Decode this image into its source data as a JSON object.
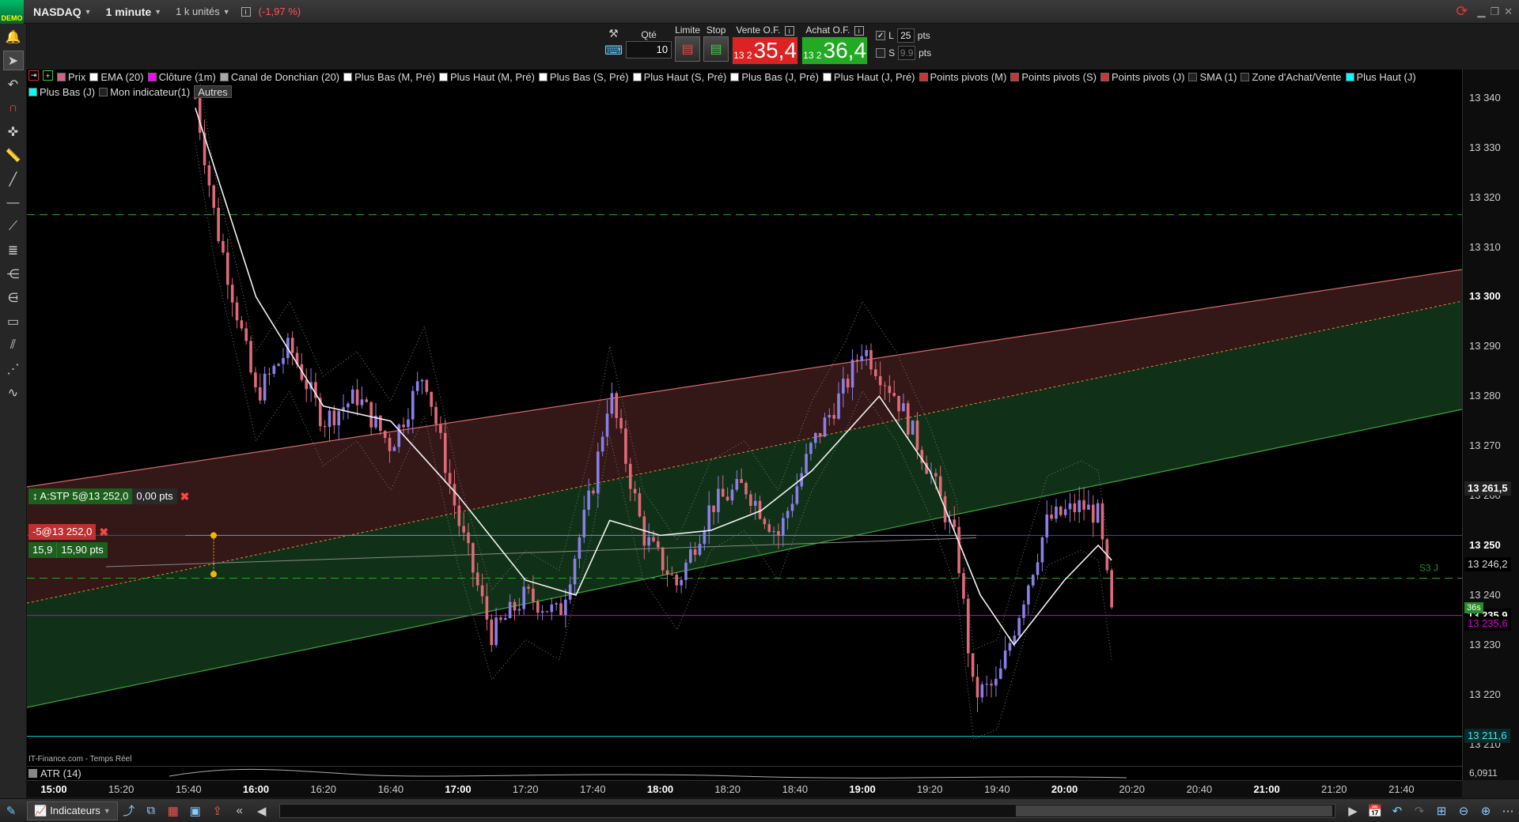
{
  "topbar": {
    "demo_label": "DEMO",
    "instrument": "NASDAQ",
    "timeframe": "1 minute",
    "units": "1 k unités",
    "change": "(-1,97 %)",
    "info_icon": "info-icon",
    "sync_icon": "sync-icon"
  },
  "order_panel": {
    "qty_label": "Qté",
    "qty_value": "10",
    "limit_label": "Limite",
    "stop_label": "Stop",
    "sell_label": "Vente O.F.",
    "buy_label": "Achat O.F.",
    "sell_prefix": "13 2",
    "sell_price": "35,4",
    "buy_prefix": "13 2",
    "buy_price": "36,4",
    "l_label": "L",
    "l_value": "25",
    "l_unit": "pts",
    "s_label": "S",
    "s_value": "9.9",
    "s_unit": "pts",
    "sell_color": "#dd2222",
    "buy_color": "#22aa22"
  },
  "legend": {
    "row1": [
      {
        "label": "Prix",
        "color": "#cc6688"
      },
      {
        "label": "EMA (20)",
        "color": "#ffffff"
      },
      {
        "label": "Clôture (1m)",
        "color": "#ff00ff"
      },
      {
        "label": "Canal de Donchian (20)",
        "color": "#aaaaaa"
      },
      {
        "label": "Plus Bas (M, Pré)",
        "color": "#ffffff"
      },
      {
        "label": "Plus Haut (M, Pré)",
        "color": "#ffffff"
      },
      {
        "label": "Plus Bas (S, Pré)",
        "color": "#ffffff"
      },
      {
        "label": "Plus Haut (S, Pré)",
        "color": "#ffffff"
      },
      {
        "label": "Plus Bas (J, Pré)",
        "color": "#ffffff"
      },
      {
        "label": "Plus Haut (J, Pré)",
        "color": "#ffffff"
      },
      {
        "label": "Points pivots (M)",
        "color": "#cc3333"
      },
      {
        "label": "Points pivots (S)",
        "color": "#cc3333"
      },
      {
        "label": "Points pivots (J)",
        "color": "#cc3333"
      },
      {
        "label": "SMA (1)",
        "color": "#222222"
      },
      {
        "label": "Zone d'Achat/Vente",
        "color": "#222222"
      },
      {
        "label": "Plus Haut (J)",
        "color": "#00ffff"
      }
    ],
    "row2": [
      {
        "label": "Plus Bas (J)",
        "color": "#00ffff"
      },
      {
        "label": "Mon indicateur(1)",
        "color": "#222222"
      }
    ],
    "more_label": "Autres"
  },
  "price_axis": {
    "ticks": [
      "13 340",
      "13 330",
      "13 320",
      "13 310",
      "13 300",
      "13 290",
      "13 280",
      "13 270",
      "13 260",
      "13 250",
      "13 240",
      "13 230",
      "13 220",
      "13 210"
    ],
    "last_price": "13 261,5",
    "tag_246": "13 246,2",
    "tag_235": "13 235,9",
    "tag_235b": "13 235,6",
    "tag_211": "13 211,6",
    "countdown": "36s"
  },
  "time_axis": {
    "ticks": [
      "15:00",
      "15:20",
      "15:40",
      "16:00",
      "16:20",
      "16:40",
      "17:00",
      "17:20",
      "17:40",
      "18:00",
      "18:20",
      "18:40",
      "19:00",
      "19:20",
      "19:40",
      "20:00",
      "20:20",
      "20:40",
      "21:00",
      "21:20",
      "21:40"
    ]
  },
  "orders": {
    "stop_tag": "A:STP 5@13 252,0",
    "stop_pts": "0,00 pts",
    "position_tag": "-5@13 252,0",
    "pnl_value": "15,9",
    "pnl_pts": "15,90 pts"
  },
  "chart_labels": {
    "s3j": "S3 J",
    "source": "IT-Finance.com - Temps Réel",
    "atr_label": "ATR (14)",
    "atr_value": "6,0911"
  },
  "bottombar": {
    "indicators_label": "Indicateurs"
  },
  "chart_data": {
    "type": "candlestick",
    "x_ticks": [
      "15:00",
      "15:20",
      "15:40",
      "16:00",
      "16:20",
      "16:40",
      "17:00",
      "17:20",
      "17:40",
      "18:00",
      "18:20",
      "18:40",
      "19:00",
      "19:20",
      "19:40",
      "20:00",
      "20:20",
      "20:40",
      "21:00",
      "21:20",
      "21:40"
    ],
    "ylim": [
      13205,
      13345
    ],
    "y_ticks": [
      13210,
      13220,
      13230,
      13240,
      13250,
      13260,
      13270,
      13280,
      13290,
      13300,
      13310,
      13320,
      13330,
      13340
    ],
    "last_price": 13235.9,
    "horizontal_lines": [
      {
        "name": "S3 J",
        "value": 13243.4,
        "color": "#22aa22",
        "style": "dashed"
      },
      {
        "name": "Plus Bas (J)",
        "value": 13211.6,
        "color": "#00cccc",
        "style": "solid"
      },
      {
        "name": "Clôture (1m)",
        "value": 13235.9,
        "color": "#cc00cc",
        "style": "solid"
      },
      {
        "name": "upper dashed",
        "value": 13316.5,
        "color": "#22aa22",
        "style": "dashed"
      },
      {
        "name": "Mon indicateur(1)",
        "value": 13252.0,
        "color": "#2255cc",
        "style": "solid"
      }
    ],
    "price_path": [
      {
        "t": "15:42",
        "v": 13340
      },
      {
        "t": "15:48",
        "v": 13315
      },
      {
        "t": "15:55",
        "v": 13295
      },
      {
        "t": "16:00",
        "v": 13280
      },
      {
        "t": "16:10",
        "v": 13290
      },
      {
        "t": "16:20",
        "v": 13275
      },
      {
        "t": "16:30",
        "v": 13280
      },
      {
        "t": "16:40",
        "v": 13270
      },
      {
        "t": "16:50",
        "v": 13285
      },
      {
        "t": "17:00",
        "v": 13255
      },
      {
        "t": "17:10",
        "v": 13232
      },
      {
        "t": "17:20",
        "v": 13240
      },
      {
        "t": "17:30",
        "v": 13236
      },
      {
        "t": "17:40",
        "v": 13262
      },
      {
        "t": "17:45",
        "v": 13281
      },
      {
        "t": "17:55",
        "v": 13252
      },
      {
        "t": "18:05",
        "v": 13242
      },
      {
        "t": "18:15",
        "v": 13258
      },
      {
        "t": "18:25",
        "v": 13262
      },
      {
        "t": "18:35",
        "v": 13252
      },
      {
        "t": "18:45",
        "v": 13270
      },
      {
        "t": "18:55",
        "v": 13282
      },
      {
        "t": "19:00",
        "v": 13290
      },
      {
        "t": "19:10",
        "v": 13280
      },
      {
        "t": "19:20",
        "v": 13265
      },
      {
        "t": "19:28",
        "v": 13250
      },
      {
        "t": "19:33",
        "v": 13220
      },
      {
        "t": "19:40",
        "v": 13222
      },
      {
        "t": "19:48",
        "v": 13240
      },
      {
        "t": "19:55",
        "v": 13255
      },
      {
        "t": "20:05",
        "v": 13258
      },
      {
        "t": "20:10",
        "v": 13256
      },
      {
        "t": "20:14",
        "v": 13236
      }
    ],
    "ema_path": [
      {
        "t": "15:42",
        "v": 13338
      },
      {
        "t": "16:00",
        "v": 13300
      },
      {
        "t": "16:20",
        "v": 13278
      },
      {
        "t": "16:40",
        "v": 13275
      },
      {
        "t": "17:00",
        "v": 13260
      },
      {
        "t": "17:20",
        "v": 13243
      },
      {
        "t": "17:35",
        "v": 13240
      },
      {
        "t": "17:45",
        "v": 13255
      },
      {
        "t": "18:00",
        "v": 13252
      },
      {
        "t": "18:15",
        "v": 13253
      },
      {
        "t": "18:30",
        "v": 13257
      },
      {
        "t": "18:45",
        "v": 13265
      },
      {
        "t": "19:05",
        "v": 13280
      },
      {
        "t": "19:20",
        "v": 13265
      },
      {
        "t": "19:35",
        "v": 13240
      },
      {
        "t": "19:45",
        "v": 13230
      },
      {
        "t": "20:00",
        "v": 13243
      },
      {
        "t": "20:10",
        "v": 13250
      },
      {
        "t": "20:14",
        "v": 13247
      }
    ]
  }
}
